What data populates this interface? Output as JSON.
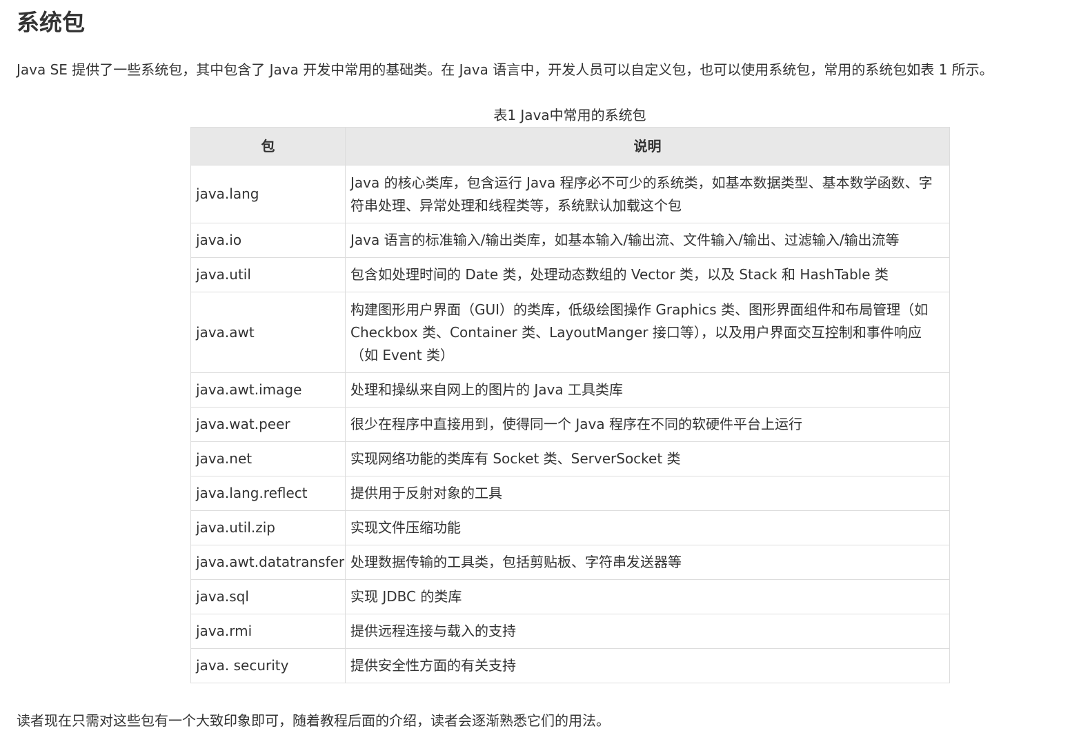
{
  "title": "系统包",
  "intro": "Java SE 提供了一些系统包，其中包含了 Java 开发中常用的基础类。在 Java 语言中，开发人员可以自定义包，也可以使用系统包，常用的系统包如表 1 所示。",
  "table": {
    "caption": "表1 Java中常用的系统包",
    "headers": [
      "包",
      "说明"
    ],
    "rows": [
      {
        "package": "java.lang",
        "description": "Java 的核心类库，包含运行 Java 程序必不可少的系统类，如基本数据类型、基本数学函数、字符串处理、异常处理和线程类等，系统默认加载这个包"
      },
      {
        "package": "java.io",
        "description": "Java 语言的标准输入/输出类库，如基本输入/输出流、文件输入/输出、过滤输入/输出流等"
      },
      {
        "package": "java.util",
        "description": "包含如处理时间的 Date 类，处理动态数组的 Vector 类，以及 Stack 和 HashTable 类"
      },
      {
        "package": "java.awt",
        "description": "构建图形用户界面（GUI）的类库，低级绘图操作 Graphics 类、图形界面组件和布局管理（如 Checkbox 类、Container 类、LayoutManger 接口等），以及用户界面交互控制和事件响应（如 Event 类）"
      },
      {
        "package": "java.awt.image",
        "description": "处理和操纵来自网上的图片的 Java 工具类库"
      },
      {
        "package": "java.wat.peer",
        "description": "很少在程序中直接用到，使得同一个 Java 程序在不同的软硬件平台上运行"
      },
      {
        "package": "java.net",
        "description": "实现网络功能的类库有 Socket 类、ServerSocket 类"
      },
      {
        "package": "java.lang.reflect",
        "description": "提供用于反射对象的工具"
      },
      {
        "package": "java.util.zip",
        "description": "实现文件压缩功能"
      },
      {
        "package": "java.awt.datatransfer",
        "description": "处理数据传输的工具类，包括剪贴板、字符串发送器等"
      },
      {
        "package": "java.sql",
        "description": "实现 JDBC 的类库"
      },
      {
        "package": "java.rmi",
        "description": "提供远程连接与载入的支持"
      },
      {
        "package": "java. security",
        "description": "提供安全性方面的有关支持"
      }
    ]
  },
  "outro": "读者现在只需对这些包有一个大致印象即可，随着教程后面的介绍，读者会逐渐熟悉它们的用法。"
}
